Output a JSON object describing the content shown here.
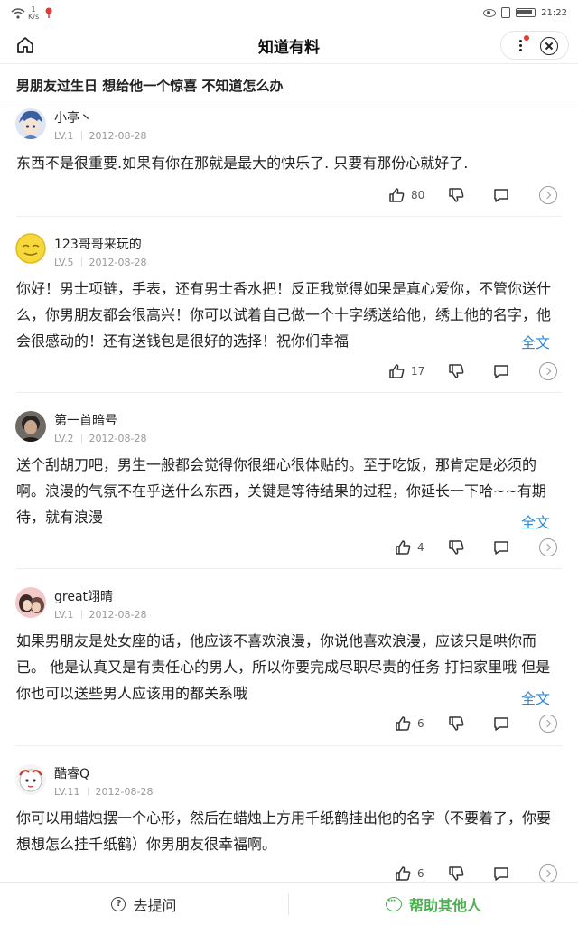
{
  "status_bar": {
    "speed_top": "1",
    "speed_unit": "K/s",
    "time": "21:22"
  },
  "header": {
    "title": "知道有料"
  },
  "question": {
    "title": "男朋友过生日 想给他一个惊喜 不知道怎么办"
  },
  "answers": [
    {
      "user": "小亭丶",
      "level": "LV.1",
      "date": "2012-08-28",
      "text": "东西不是很重要.如果有你在那就是最大的快乐了. 只要有那份心就好了.",
      "likes": "80",
      "full": ""
    },
    {
      "user": "123哥哥来玩的",
      "level": "LV.5",
      "date": "2012-08-28",
      "text": "你好！男士项链，手表，还有男士香水把！反正我觉得如果是真心爱你，不管你送什么，你男朋友都会很高兴！你可以试着自己做一个十字绣送给他，绣上他的名字，他会很感动的！还有送钱包是很好的选择！祝你们幸福",
      "likes": "17",
      "full": "全文"
    },
    {
      "user": "第一首暗号",
      "level": "LV.2",
      "date": "2012-08-28",
      "text": "送个刮胡刀吧，男生一般都会觉得你很细心很体贴的。至于吃饭，那肯定是必须的啊。浪漫的气氛不在乎送什么东西，关键是等待结果的过程，你延长一下哈~~有期待，就有浪漫",
      "likes": "4",
      "full": "全文"
    },
    {
      "user": "great翊晴",
      "level": "LV.1",
      "date": "2012-08-28",
      "text": "如果男朋友是处女座的话，他应该不喜欢浪漫，你说他喜欢浪漫，应该只是哄你而已。 他是认真又是有责任心的男人，所以你要完成尽职尽责的任务 打扫家里哦 但是你也可以送些男人应该用的都关系哦",
      "likes": "6",
      "full": "全文"
    },
    {
      "user": "酷睿Q",
      "level": "LV.11",
      "date": "2012-08-28",
      "text": "你可以用蜡烛摆一个心形，然后在蜡烛上方用千纸鹤挂出他的名字（不要着了，你要想想怎么挂千纸鹤）你男朋友很幸福啊。",
      "likes": "6",
      "full": ""
    }
  ],
  "bottom": {
    "ask_label": "去提问",
    "help_label": "帮助其他人"
  },
  "colors": {
    "link": "#2f8ad8",
    "help_green": "#4caf50"
  }
}
